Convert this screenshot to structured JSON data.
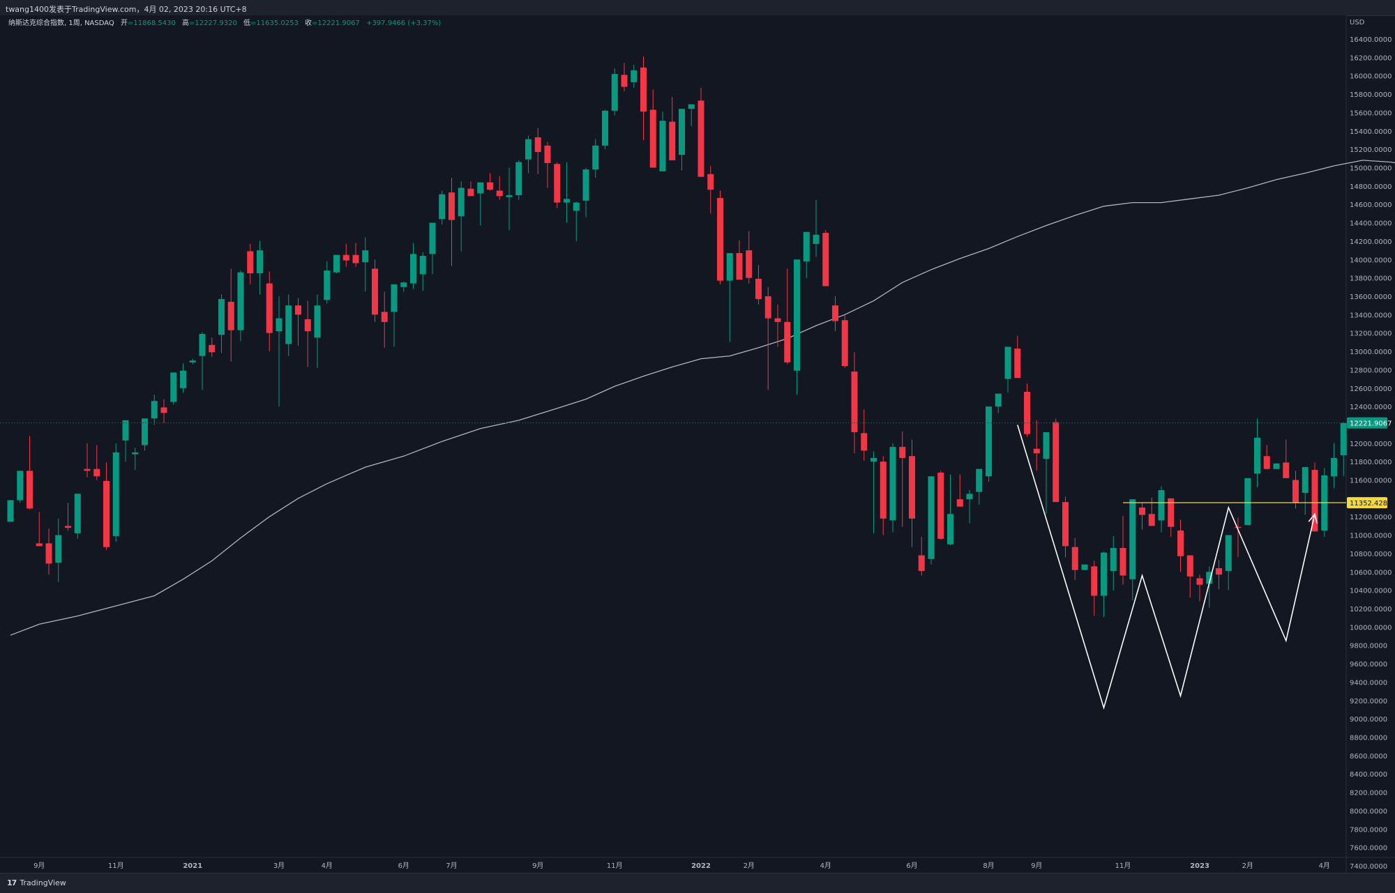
{
  "header": {
    "publisher_line": "twang1400发表于TradingView.com，4月 02, 2023 20:16 UTC+8"
  },
  "legend": {
    "symbol": "纳斯达克综合指数, 1周, NASDAQ",
    "open_label": "开",
    "open": "=11868.5430",
    "high_label": "高",
    "high": "=12227.9320",
    "low_label": "低",
    "low": "=11635.0253",
    "close_label": "收",
    "close": "=12221.9067",
    "change": "+397.9466 (+3.37%)"
  },
  "footer": {
    "brand": "TradingView",
    "brand_mark": "17"
  },
  "colors": {
    "background": "#131722",
    "up": "#089981",
    "down": "#f23645",
    "ma": "#b2b5be",
    "hline": "#f7d93b",
    "pattern": "#ffffff"
  },
  "chart_data": {
    "type": "candlestick",
    "currency": "USD",
    "y_ticks": [
      "16400.0000",
      "16200.0000",
      "16000.0000",
      "15800.0000",
      "15600.0000",
      "15400.0000",
      "15200.0000",
      "15000.0000",
      "14800.0000",
      "14600.0000",
      "14400.0000",
      "14200.0000",
      "14000.0000",
      "13800.0000",
      "13600.0000",
      "13400.0000",
      "13200.0000",
      "13000.0000",
      "12800.0000",
      "12600.0000",
      "12400.0000",
      "12000.0000",
      "11800.0000",
      "11600.0000",
      "11200.0000",
      "11000.0000",
      "10800.0000",
      "10600.0000",
      "10400.0000",
      "10200.0000",
      "10000.0000",
      "9800.0000",
      "9600.0000",
      "9400.0000",
      "9200.0000",
      "9000.0000",
      "8800.0000",
      "8600.0000",
      "8400.0000",
      "8200.0000",
      "8000.0000",
      "7800.0000",
      "7600.0000",
      "7400.0000"
    ],
    "x_ticks": [
      {
        "label": "9月",
        "i": 3
      },
      {
        "label": "11月",
        "i": 11
      },
      {
        "label": "2021",
        "i": 19,
        "bold": true
      },
      {
        "label": "3月",
        "i": 28
      },
      {
        "label": "4月",
        "i": 33
      },
      {
        "label": "6月",
        "i": 41
      },
      {
        "label": "7月",
        "i": 46
      },
      {
        "label": "9月",
        "i": 55
      },
      {
        "label": "11月",
        "i": 63
      },
      {
        "label": "2022",
        "i": 72,
        "bold": true
      },
      {
        "label": "2月",
        "i": 77
      },
      {
        "label": "4月",
        "i": 85
      },
      {
        "label": "6月",
        "i": 94
      },
      {
        "label": "8月",
        "i": 102
      },
      {
        "label": "9月",
        "i": 107
      },
      {
        "label": "11月",
        "i": 116
      },
      {
        "label": "2023",
        "i": 124,
        "bold": true
      },
      {
        "label": "2月",
        "i": 129
      },
      {
        "label": "4月",
        "i": 137
      }
    ],
    "current_price": {
      "value": 12221.9067,
      "label": "12221.9067"
    },
    "horizontal_line": {
      "value": 11352.4289,
      "label": "11352.4289",
      "start_i": 116
    },
    "candles": [
      [
        11145,
        11385,
        11145,
        11380
      ],
      [
        11380,
        11690,
        11350,
        11700
      ],
      [
        11700,
        12080,
        11280,
        11290
      ],
      [
        10910,
        11250,
        10880,
        10880
      ],
      [
        10910,
        11070,
        10570,
        10690
      ],
      [
        10700,
        11180,
        10490,
        11000
      ],
      [
        11100,
        11350,
        11050,
        11080
      ],
      [
        11020,
        11450,
        10960,
        11450
      ],
      [
        11720,
        12000,
        11630,
        11700
      ],
      [
        11720,
        11980,
        11600,
        11640
      ],
      [
        11590,
        11790,
        10840,
        10870
      ],
      [
        10990,
        12000,
        10930,
        11900
      ],
      [
        12030,
        12150,
        11800,
        12250
      ],
      [
        11880,
        11950,
        11710,
        11900
      ],
      [
        11980,
        12150,
        11920,
        12270
      ],
      [
        12270,
        12530,
        12200,
        12460
      ],
      [
        12390,
        12480,
        12220,
        12330
      ],
      [
        12450,
        12750,
        12420,
        12770
      ],
      [
        12600,
        12870,
        12550,
        12790
      ],
      [
        12880,
        12920,
        12860,
        12900
      ],
      [
        12950,
        13210,
        12580,
        13190
      ],
      [
        13070,
        13150,
        12940,
        12990
      ],
      [
        13180,
        13620,
        12980,
        13570
      ],
      [
        13540,
        13900,
        12890,
        13230
      ],
      [
        13230,
        13880,
        13110,
        13860
      ],
      [
        14090,
        14170,
        13730,
        13850
      ],
      [
        13850,
        14200,
        13620,
        14100
      ],
      [
        13740,
        13870,
        13000,
        13200
      ],
      [
        13220,
        13600,
        12400,
        13360
      ],
      [
        13080,
        13620,
        12950,
        13500
      ],
      [
        13500,
        13580,
        13060,
        13400
      ],
      [
        13350,
        13550,
        12830,
        13220
      ],
      [
        13150,
        13620,
        12820,
        13500
      ],
      [
        13560,
        13980,
        13520,
        13880
      ],
      [
        13860,
        14040,
        13850,
        14050
      ],
      [
        14050,
        14170,
        13920,
        13990
      ],
      [
        14050,
        14180,
        13920,
        13960
      ],
      [
        13970,
        14240,
        13650,
        14100
      ],
      [
        13900,
        14000,
        13320,
        13400
      ],
      [
        13430,
        13650,
        13040,
        13320
      ],
      [
        13430,
        13700,
        13050,
        13730
      ],
      [
        13700,
        13760,
        13650,
        13750
      ],
      [
        13740,
        14180,
        13680,
        14060
      ],
      [
        13840,
        14080,
        13660,
        14040
      ],
      [
        14060,
        14330,
        13840,
        14400
      ],
      [
        14440,
        14750,
        14380,
        14710
      ],
      [
        14730,
        14890,
        13930,
        14430
      ],
      [
        14470,
        14850,
        14090,
        14780
      ],
      [
        14770,
        14850,
        14720,
        14690
      ],
      [
        14720,
        14800,
        14370,
        14840
      ],
      [
        14840,
        14940,
        14750,
        14760
      ],
      [
        14750,
        14910,
        14650,
        14690
      ],
      [
        14680,
        15000,
        14320,
        14700
      ],
      [
        14700,
        15080,
        14650,
        15060
      ],
      [
        15090,
        15350,
        14940,
        15310
      ],
      [
        15330,
        15430,
        14930,
        15170
      ],
      [
        15240,
        15280,
        14780,
        15050
      ],
      [
        15040,
        15060,
        14560,
        14620
      ],
      [
        14620,
        15060,
        14400,
        14660
      ],
      [
        14530,
        14630,
        14200,
        14620
      ],
      [
        14640,
        15000,
        14460,
        14980
      ],
      [
        14980,
        15310,
        14890,
        15240
      ],
      [
        15240,
        15630,
        15200,
        15620
      ],
      [
        15620,
        16080,
        15570,
        16020
      ],
      [
        16010,
        16140,
        15830,
        15880
      ],
      [
        15930,
        16120,
        15870,
        16060
      ],
      [
        16090,
        16210,
        15300,
        15610
      ],
      [
        15630,
        15850,
        15040,
        15000
      ],
      [
        14960,
        15610,
        14960,
        15510
      ],
      [
        15500,
        15770,
        15190,
        15080
      ],
      [
        15140,
        15640,
        14970,
        15640
      ],
      [
        15640,
        15690,
        15450,
        15690
      ],
      [
        15730,
        15870,
        15040,
        14900
      ],
      [
        14930,
        15020,
        14500,
        14760
      ],
      [
        14670,
        14750,
        13730,
        13770
      ],
      [
        13770,
        14060,
        13100,
        14070
      ],
      [
        14070,
        14210,
        13790,
        13780
      ],
      [
        14100,
        14310,
        13740,
        13800
      ],
      [
        13790,
        13940,
        13510,
        13570
      ],
      [
        13600,
        13700,
        12580,
        13360
      ],
      [
        13360,
        13510,
        13050,
        13320
      ],
      [
        13320,
        13900,
        12860,
        12880
      ],
      [
        12790,
        13980,
        12530,
        14000
      ],
      [
        13980,
        14260,
        13800,
        14300
      ],
      [
        14170,
        14650,
        14030,
        14270
      ],
      [
        14290,
        14320,
        13710,
        13710
      ],
      [
        13500,
        13600,
        13220,
        13330
      ],
      [
        13340,
        13410,
        12820,
        12840
      ],
      [
        12780,
        12990,
        11890,
        12120
      ],
      [
        12110,
        12370,
        11810,
        11920
      ],
      [
        11800,
        11910,
        11020,
        11840
      ],
      [
        11800,
        11860,
        11000,
        11180
      ],
      [
        11160,
        12000,
        11030,
        11960
      ],
      [
        11960,
        12130,
        11090,
        11840
      ],
      [
        11860,
        12040,
        10870,
        11180
      ],
      [
        10780,
        10980,
        10560,
        10610
      ],
      [
        10740,
        11630,
        10680,
        11640
      ],
      [
        11680,
        11700,
        10950,
        10960
      ],
      [
        10900,
        11660,
        10890,
        11230
      ],
      [
        11390,
        11660,
        11310,
        11310
      ],
      [
        11390,
        11490,
        11130,
        11450
      ],
      [
        11470,
        11720,
        11330,
        11720
      ],
      [
        11640,
        12380,
        11580,
        12400
      ],
      [
        12400,
        12470,
        12330,
        12540
      ],
      [
        12700,
        12980,
        12550,
        13050
      ],
      [
        13030,
        13170,
        12720,
        12710
      ],
      [
        12560,
        12650,
        12070,
        12100
      ],
      [
        11940,
        12250,
        11700,
        11890
      ],
      [
        11830,
        12000,
        11230,
        12120
      ],
      [
        12230,
        12270,
        11390,
        11360
      ],
      [
        11360,
        11420,
        10760,
        10880
      ],
      [
        10870,
        10970,
        10510,
        10620
      ],
      [
        10620,
        10670,
        10690,
        10680
      ],
      [
        10660,
        10720,
        10120,
        10340
      ],
      [
        10340,
        10820,
        10110,
        10810
      ],
      [
        10610,
        10990,
        10400,
        10860
      ],
      [
        10860,
        11210,
        10460,
        10560
      ],
      [
        10520,
        11380,
        10290,
        11390
      ],
      [
        11300,
        11350,
        11060,
        11220
      ],
      [
        11230,
        11410,
        11150,
        11100
      ],
      [
        11160,
        11530,
        11030,
        11490
      ],
      [
        11400,
        11400,
        10980,
        11090
      ],
      [
        11050,
        11170,
        10600,
        10770
      ],
      [
        10780,
        10780,
        10320,
        10550
      ],
      [
        10530,
        10570,
        10280,
        10460
      ],
      [
        10470,
        10660,
        10210,
        10600
      ],
      [
        10640,
        10730,
        10410,
        10570
      ],
      [
        10610,
        10720,
        10400,
        11000
      ],
      [
        11090,
        11190,
        10760,
        11080
      ],
      [
        11110,
        11550,
        11140,
        11620
      ],
      [
        11670,
        12270,
        11520,
        12060
      ],
      [
        11860,
        11980,
        11730,
        11720
      ],
      [
        11720,
        11770,
        11730,
        11780
      ],
      [
        11790,
        12040,
        11660,
        11620
      ],
      [
        11600,
        11700,
        11290,
        11350
      ],
      [
        11460,
        11730,
        11220,
        11740
      ],
      [
        11710,
        11790,
        11140,
        11040
      ],
      [
        11050,
        11730,
        10980,
        11650
      ],
      [
        11640,
        12000,
        11510,
        11840
      ],
      [
        11870,
        12230,
        11640,
        12220
      ]
    ],
    "ma20": [
      [
        0,
        9910
      ],
      [
        3,
        10030
      ],
      [
        7,
        10120
      ],
      [
        11,
        10230
      ],
      [
        15,
        10340
      ],
      [
        18,
        10520
      ],
      [
        21,
        10720
      ],
      [
        24,
        10970
      ],
      [
        27,
        11200
      ],
      [
        30,
        11400
      ],
      [
        33,
        11560
      ],
      [
        37,
        11740
      ],
      [
        41,
        11860
      ],
      [
        45,
        12020
      ],
      [
        49,
        12160
      ],
      [
        53,
        12250
      ],
      [
        57,
        12380
      ],
      [
        60,
        12480
      ],
      [
        63,
        12620
      ],
      [
        66,
        12730
      ],
      [
        69,
        12830
      ],
      [
        72,
        12920
      ],
      [
        75,
        12950
      ],
      [
        78,
        13040
      ],
      [
        81,
        13140
      ],
      [
        84,
        13280
      ],
      [
        87,
        13400
      ],
      [
        90,
        13550
      ],
      [
        93,
        13750
      ],
      [
        96,
        13890
      ],
      [
        99,
        14010
      ],
      [
        102,
        14120
      ],
      [
        105,
        14250
      ],
      [
        108,
        14370
      ],
      [
        111,
        14480
      ],
      [
        114,
        14580
      ],
      [
        117,
        14620
      ],
      [
        120,
        14620
      ],
      [
        123,
        14660
      ],
      [
        126,
        14700
      ],
      [
        129,
        14780
      ],
      [
        132,
        14870
      ],
      [
        135,
        14940
      ],
      [
        138,
        15020
      ],
      [
        141,
        15080
      ],
      [
        144,
        15060
      ],
      [
        147,
        15000
      ],
      [
        150,
        14900
      ]
    ],
    "pattern_w": [
      [
        105,
        12200
      ],
      [
        114,
        9120
      ],
      [
        118,
        10560
      ],
      [
        122,
        9250
      ],
      [
        127,
        11300
      ],
      [
        133,
        9850
      ],
      [
        136,
        11230
      ]
    ]
  }
}
